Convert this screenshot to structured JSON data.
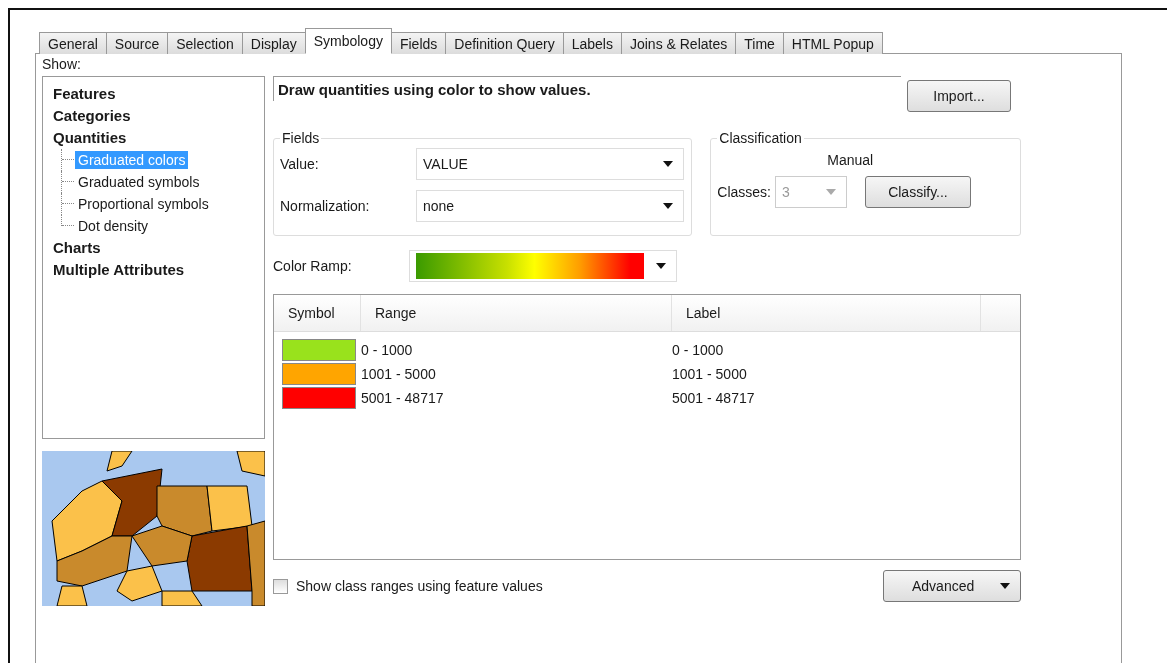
{
  "tabs": [
    {
      "label": "General",
      "selected": false
    },
    {
      "label": "Source",
      "selected": false
    },
    {
      "label": "Selection",
      "selected": false
    },
    {
      "label": "Display",
      "selected": false
    },
    {
      "label": "Symbology",
      "selected": true
    },
    {
      "label": "Fields",
      "selected": false
    },
    {
      "label": "Definition Query",
      "selected": false
    },
    {
      "label": "Labels",
      "selected": false
    },
    {
      "label": "Joins & Relates",
      "selected": false
    },
    {
      "label": "Time",
      "selected": false
    },
    {
      "label": "HTML Popup",
      "selected": false
    }
  ],
  "show_label": "Show:",
  "tree": [
    {
      "label": "Features",
      "selected": false
    },
    {
      "label": "Categories",
      "selected": false
    },
    {
      "label": "Quantities",
      "selected": false,
      "children": [
        {
          "label": "Graduated colors",
          "selected": true
        },
        {
          "label": "Graduated symbols",
          "selected": false
        },
        {
          "label": "Proportional symbols",
          "selected": false
        },
        {
          "label": "Dot density",
          "selected": false
        }
      ]
    },
    {
      "label": "Charts",
      "selected": false
    },
    {
      "label": "Multiple Attributes",
      "selected": false
    }
  ],
  "description": "Draw quantities using color to show values.",
  "import_button": "Import...",
  "fields_group": {
    "title": "Fields",
    "value_label": "Value:",
    "value": "VALUE",
    "normalization_label": "Normalization:",
    "normalization": "none"
  },
  "classification_group": {
    "title": "Classification",
    "method": "Manual",
    "classes_label": "Classes:",
    "classes": "3",
    "classes_disabled": true,
    "classify_button": "Classify..."
  },
  "color_ramp_label": "Color Ramp:",
  "table": {
    "columns": [
      "Symbol",
      "Range",
      "Label"
    ],
    "rows": [
      {
        "color": "#99e21c",
        "range": "0 - 1000",
        "label": "0 - 1000"
      },
      {
        "color": "#ffa500",
        "range": "1001 - 5000",
        "label": "1001 - 5000"
      },
      {
        "color": "#ff0000",
        "range": "5001 - 48717",
        "label": "5001 - 48717"
      }
    ]
  },
  "show_class_ranges": {
    "label": "Show class ranges using feature values",
    "checked": false
  },
  "advanced_button": "Advanced"
}
